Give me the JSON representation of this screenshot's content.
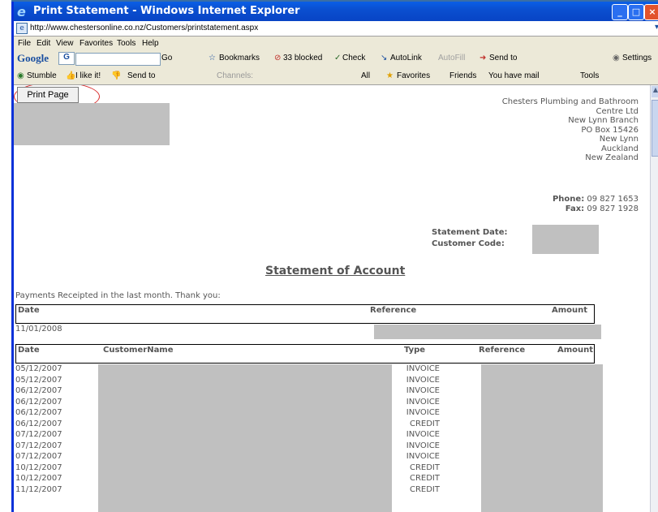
{
  "window": {
    "title": "Print Statement - Windows Internet Explorer",
    "url": "http://www.chestersonline.co.nz/Customers/printstatement.aspx"
  },
  "menu": [
    "File",
    "Edit",
    "View",
    "Favorites",
    "Tools",
    "Help"
  ],
  "google_toolbar": {
    "logo": "Google",
    "g_label": "G",
    "go": "Go",
    "bookmarks": "Bookmarks",
    "blocked": "33 blocked",
    "check": "Check",
    "autolink": "AutoLink",
    "autofill": "AutoFill",
    "send_to": "Send to",
    "settings": "Settings"
  },
  "stumble_toolbar": {
    "stumble": "Stumble",
    "like": "I like it!",
    "send_to": "Send to",
    "channels": "Channels:",
    "all": "All",
    "favorites": "Favorites",
    "friends": "Friends",
    "mail": "You have mail",
    "tools": "Tools"
  },
  "print_button": "Print Page",
  "company": {
    "lines": [
      "Chesters Plumbing and Bathroom",
      "Centre Ltd",
      "New Lynn Branch",
      "PO Box 15426",
      "New Lynn",
      "Auckland",
      "New Zealand"
    ],
    "phone_label": "Phone:",
    "phone": "09 827 1653",
    "fax_label": "Fax:",
    "fax": "09 827 1928"
  },
  "statement": {
    "date_label": "Statement Date:",
    "code_label": "Customer Code:",
    "heading": "Statement of Account",
    "payments_text": "Payments Receipted in the last month. Thank you:"
  },
  "payments": {
    "headers": {
      "date": "Date",
      "reference": "Reference",
      "amount": "Amount"
    },
    "rows": [
      {
        "date": "11/01/2008"
      }
    ]
  },
  "invoices": {
    "headers": {
      "date": "Date",
      "customer": "CustomerName",
      "type": "Type",
      "reference": "Reference",
      "amount": "Amount"
    },
    "rows": [
      {
        "date": "05/12/2007",
        "type": "INVOICE"
      },
      {
        "date": "05/12/2007",
        "type": "INVOICE"
      },
      {
        "date": "06/12/2007",
        "type": "INVOICE"
      },
      {
        "date": "06/12/2007",
        "type": "INVOICE"
      },
      {
        "date": "06/12/2007",
        "type": "INVOICE"
      },
      {
        "date": "06/12/2007",
        "type": "CREDIT"
      },
      {
        "date": "07/12/2007",
        "type": "INVOICE"
      },
      {
        "date": "07/12/2007",
        "type": "INVOICE"
      },
      {
        "date": "07/12/2007",
        "type": "INVOICE"
      },
      {
        "date": "10/12/2007",
        "type": "CREDIT"
      },
      {
        "date": "10/12/2007",
        "type": "CREDIT"
      },
      {
        "date": "11/12/2007",
        "type": "CREDIT"
      }
    ]
  },
  "colors": {
    "titlebar": "#0a4fd0",
    "redacted": "#c0c0c0",
    "highlight": "#d92b2b"
  }
}
